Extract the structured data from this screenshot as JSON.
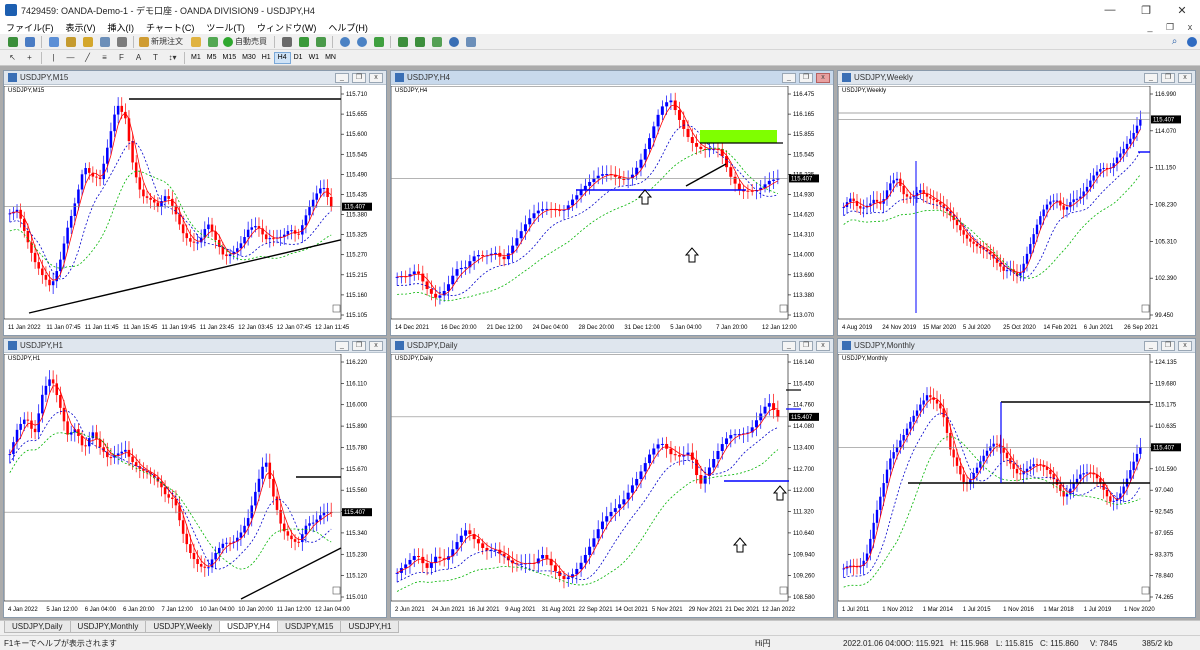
{
  "window": {
    "title": "7429459: OANDA-Demo-1 - デモ口座 - OANDA DIVISION9 - USDJPY,H4",
    "controls": [
      "—",
      "❐",
      "✕"
    ]
  },
  "menu": {
    "items": [
      "ファイル(F)",
      "表示(V)",
      "挿入(I)",
      "チャート(C)",
      "ツール(T)",
      "ウィンドウ(W)",
      "ヘルプ(H)"
    ],
    "mdi_controls": [
      "_",
      "❐",
      "x"
    ]
  },
  "toolbar": {
    "new_order": "新規注文",
    "auto_trading": "自動売買",
    "timeframes": [
      "M1",
      "M5",
      "M15",
      "M30",
      "H1",
      "H4",
      "D1",
      "W1",
      "MN"
    ],
    "active_timeframe": "H4"
  },
  "colors": {
    "bull": "#0000ff",
    "bear": "#ff0000",
    "ma_fast": "#ff0000",
    "ma_mid": "#0000cc",
    "ma_slow": "#00b400",
    "price_line": "#888888",
    "support_line": "#0000ff",
    "trend_line": "#000000",
    "target_box": "#7fff00"
  },
  "charts": {
    "m15": {
      "title": "USDJPY,M15",
      "label": "USDJPY,M15",
      "yticks": [
        "115.710",
        "115.655",
        "115.600",
        "115.545",
        "115.490",
        "115.435",
        "115.380",
        "115.325",
        "115.270",
        "115.215",
        "115.160",
        "115.105"
      ],
      "price": "115.407",
      "xticks": [
        "11 Jan 2022",
        "11 Jan 07:45",
        "11 Jan 11:45",
        "11 Jan 15:45",
        "11 Jan 19:45",
        "11 Jan 23:45",
        "12 Jan 03:45",
        "12 Jan 07:45",
        "12 Jan 11:45"
      ]
    },
    "h4": {
      "title": "USDJPY,H4",
      "label": "USDJPY,H4",
      "yticks": [
        "116.475",
        "116.165",
        "115.855",
        "115.545",
        "115.235",
        "114.930",
        "114.620",
        "114.310",
        "114.000",
        "113.690",
        "113.380",
        "113.070"
      ],
      "price": "115.407",
      "xticks": [
        "14 Dec 2021",
        "16 Dec 20:00",
        "21 Dec 12:00",
        "24 Dec 04:00",
        "28 Dec 20:00",
        "31 Dec 12:00",
        "5 Jan 04:00",
        "7 Jan 20:00",
        "12 Jan 12:00"
      ]
    },
    "weekly": {
      "title": "USDJPY,Weekly",
      "label": "USDJPY,Weekly",
      "yticks": [
        "116.990",
        "114.070",
        "111.150",
        "108.230",
        "105.310",
        "102.390",
        "99.450"
      ],
      "extra_yticks": [
        "106.730",
        "103.810",
        "100.910"
      ],
      "price": "115.407",
      "xticks": [
        "4 Aug 2019",
        "24 Nov 2019",
        "15 Mar 2020",
        "5 Jul 2020",
        "25 Oct 2020",
        "14 Feb 2021",
        "6 Jun 2021",
        "26 Sep 2021"
      ]
    },
    "h1": {
      "title": "USDJPY,H1",
      "label": "USDJPY,H1",
      "yticks": [
        "116.220",
        "116.110",
        "116.000",
        "115.890",
        "115.780",
        "115.670",
        "115.560",
        "115.450",
        "115.340",
        "115.230",
        "115.120",
        "115.010"
      ],
      "price": "115.407",
      "xticks": [
        "4 Jan 2022",
        "5 Jan 12:00",
        "6 Jan 04:00",
        "6 Jan 20:00",
        "7 Jan 12:00",
        "10 Jan 04:00",
        "10 Jan 20:00",
        "11 Jan 12:00",
        "12 Jan 04:00"
      ]
    },
    "daily": {
      "title": "USDJPY,Daily",
      "label": "USDJPY,Daily",
      "yticks": [
        "116.140",
        "115.450",
        "114.760",
        "114.080",
        "113.400",
        "112.700",
        "112.000",
        "111.320",
        "110.640",
        "109.940",
        "109.260",
        "108.580"
      ],
      "price": "115.407",
      "xticks": [
        "2 Jun 2021",
        "24 Jun 2021",
        "16 Jul 2021",
        "9 Aug 2021",
        "31 Aug 2021",
        "22 Sep 2021",
        "14 Oct 2021",
        "5 Nov 2021",
        "29 Nov 2021",
        "21 Dec 2021",
        "12 Jan 2022"
      ]
    },
    "monthly": {
      "title": "USDJPY,Monthly",
      "label": "USDJPY,Monthly",
      "yticks": [
        "124.135",
        "119.680",
        "115.175",
        "110.635",
        "106.045",
        "101.590",
        "97.040",
        "92.545",
        "87.955",
        "83.375",
        "78.840",
        "74.265"
      ],
      "price": "115.407",
      "xticks": [
        "1 Jul 2011",
        "1 Nov 2012",
        "1 Mar 2014",
        "1 Jul 2015",
        "1 Nov 2016",
        "1 Mar 2018",
        "1 Jul 2019",
        "1 Nov 2020"
      ]
    }
  },
  "tabs": [
    "USDJPY,Daily",
    "USDJPY,Monthly",
    "USDJPY,Weekly",
    "USDJPY,H4",
    "USDJPY,M15",
    "USDJPY,H1"
  ],
  "active_tab": "USDJPY,H4",
  "status": {
    "help": "F1キーでヘルプが表示されます",
    "profile": "Hi円",
    "datetime": "2022.01.06 04:00",
    "open": "O: 115.921",
    "high": "H: 115.968",
    "low": "L: 115.815",
    "close": "C: 115.860",
    "volume": "V: 7845",
    "traffic": "385/2 kb"
  }
}
